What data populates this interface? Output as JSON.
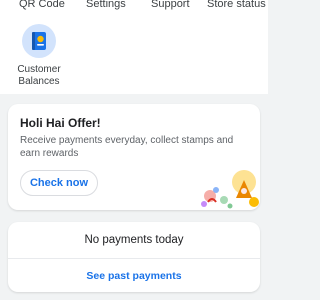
{
  "top_nav": {
    "items": [
      "QR Code",
      "Settings",
      "Support",
      "Store status"
    ]
  },
  "shortcuts": [
    {
      "label": "Customer\nBalances",
      "icon": "customer-balances-book-icon"
    }
  ],
  "offer": {
    "title": "Holi Hai Offer!",
    "description": "Receive payments everyday, collect stamps and earn rewards",
    "button_label": "Check now",
    "illustration_icon": "holi-celebration-illustration"
  },
  "payments": {
    "empty_message": "No payments today",
    "link_label": "See past payments"
  },
  "colors": {
    "accent": "#1a73e8",
    "background": "#f1f3f4",
    "card": "#ffffff"
  }
}
